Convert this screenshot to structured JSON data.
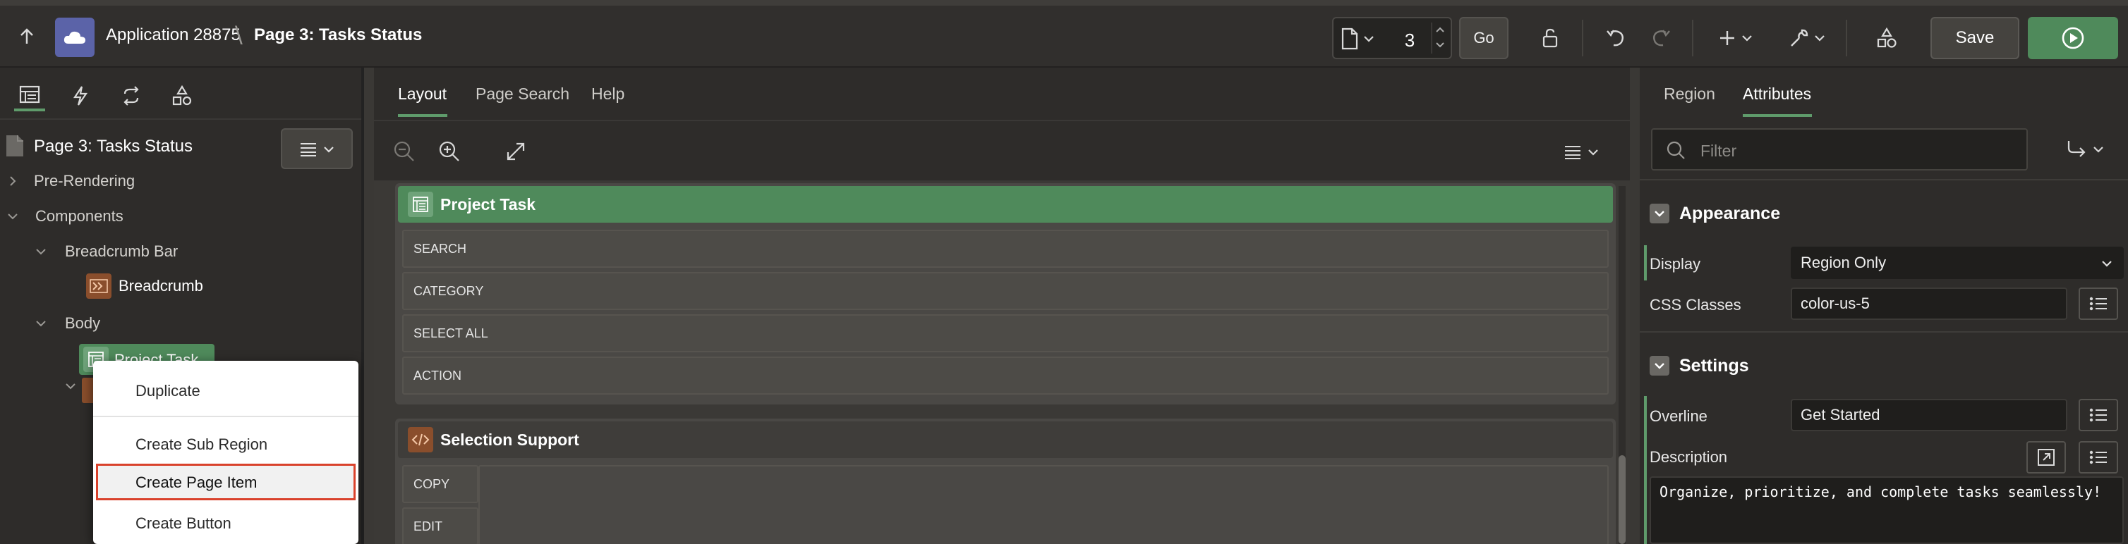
{
  "header": {
    "app_name": "Application 28875",
    "separator": "\\",
    "page_name": "Page 3: Tasks Status",
    "page_number": "3",
    "go_label": "Go",
    "save_label": "Save"
  },
  "left_panel": {
    "tree_title": "Page 3: Tasks Status",
    "nodes": {
      "pre_rendering": "Pre-Rendering",
      "components": "Components",
      "breadcrumb_bar": "Breadcrumb Bar",
      "breadcrumb": "Breadcrumb",
      "body": "Body",
      "project_task": "Project Task"
    }
  },
  "context_menu": {
    "items": [
      "Duplicate",
      "Create Sub Region",
      "Create Page Item",
      "Create Button"
    ],
    "highlighted": "Create Page Item"
  },
  "center": {
    "tabs": [
      "Layout",
      "Page Search",
      "Help"
    ],
    "active_tab": "Layout",
    "regions": [
      {
        "title": "Project Task",
        "placeholders": [
          "SEARCH",
          "CATEGORY",
          "SELECT ALL",
          "ACTION"
        ]
      },
      {
        "title": "Selection Support",
        "placeholders": [
          "COPY",
          "EDIT"
        ]
      }
    ]
  },
  "right_panel": {
    "tabs": [
      "Region",
      "Attributes"
    ],
    "active_tab": "Attributes",
    "filter_placeholder": "Filter",
    "appearance": {
      "title": "Appearance",
      "display_label": "Display",
      "display_value": "Region Only",
      "css_label": "CSS Classes",
      "css_value": "color-us-5"
    },
    "settings": {
      "title": "Settings",
      "overline_label": "Overline",
      "overline_value": "Get Started",
      "description_label": "Description",
      "description_value": "Organize, prioritize, and complete tasks seamlessly!"
    }
  },
  "colors": {
    "accent_green": "#4f8a5b",
    "highlight_red": "#d9422c",
    "app_icon": "#5b63a8",
    "html_region_badge": "#8a4e2c"
  }
}
